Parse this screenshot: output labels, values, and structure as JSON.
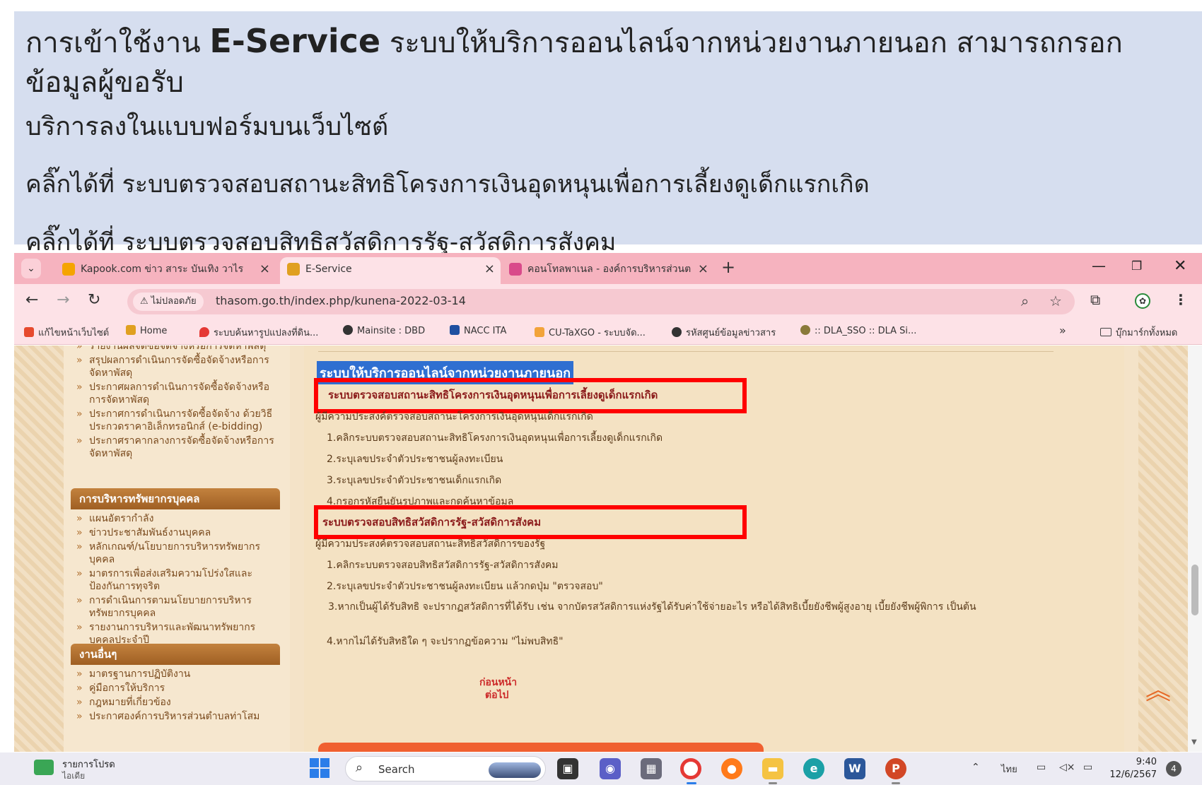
{
  "caption": {
    "line1_pre": "การเข้าใช้งาน ",
    "line1_brand": "E-Service",
    "line1_post": " ระบบให้บริการออนไลน์จากหน่วยงานภายนอก สามารถกรอกข้อมูลผู้ขอรับ",
    "line2": "บริการลงในแบบฟอร์มบนเว็บไซต์",
    "line3": "คลิ๊กได้ที่ ระบบตรวจสอบสถานะสิทธิโครงการเงินอุดหนุนเพื่อการเลี้ยงดูเด็กแรกเกิด",
    "line4": "คลิ๊กได้ที่ ระบบตรวจสอบสิทธิสวัสดิการรัฐ-สวัสดิการสังคม"
  },
  "browser": {
    "tabs": [
      {
        "title": "Kapook.com ข่าว สาระ บันเทิง วาไร",
        "favicon_color": "#f5a400",
        "active": false
      },
      {
        "title": "E-Service",
        "favicon_color": "#e0a020",
        "active": true
      },
      {
        "title": "คอนโทลพาเนล - องค์การบริหารส่วนต",
        "favicon_color": "#d94a8a",
        "active": false
      }
    ],
    "security_label": "ไม่ปลอดภัย",
    "url": "thasom.go.th/index.php/kunena-2022-03-14",
    "bookmarks": [
      "แก้ไขหน้าเว็บไซต์",
      "Home",
      "ระบบค้นหารูปแปลงที่ดิน...",
      "Mainsite : DBD",
      "NACC ITA",
      "CU-TaXGO - ระบบจัด...",
      "รหัสศูนย์ข้อมูลข่าวสาร",
      ":: DLA_SSO :: DLA Si..."
    ],
    "all_bookmarks": "บุ๊กมาร์กทั้งหมด"
  },
  "sidebar": {
    "top_items": [
      "รายงานผลจัดซื้อจัดจ้างหรือการจัดหาพัสดุ",
      "สรุปผลการดำเนินการจัดซื้อจัดจ้างหรือการจัดหาพัสดุ",
      "ประกาศผลการดำเนินการจัดซื้อจัดจ้างหรือการจัดหาพัสดุ",
      "ประกาศการดำเนินการจัดซื้อจัดจ้าง ด้วยวิธีประกวดราคาอิเล็กทรอนิกส์ (e-bidding)",
      "ประกาศราคากลางการจัดซื้อจัดจ้างหรือการจัดหาพัสดุ"
    ],
    "hr_header": "การบริหารทรัพยากรบุคคล",
    "hr_items": [
      "แผนอัตรากำลัง",
      "ข่าวประชาสัมพันธ์งานบุคคล",
      "หลักเกณฑ์/นโยบายการบริหารทรัพยากรบุคคล",
      "มาตรการเพื่อส่งเสริมความโปร่งใสและป้องกันการทุจริต",
      "การดำเนินการตามนโยบายการบริหารทรัพยากรบุคคล",
      "รายงานการบริหารและพัฒนาทรัพยากรบุคคลประจำปี"
    ],
    "other_header": "งานอื่นๆ",
    "other_items": [
      "มาตรฐานการปฏิบัติงาน",
      "คู่มือการให้บริการ",
      "กฎหมายที่เกี่ยวข้อง",
      "ประกาศองค์การบริหารส่วนตำบลท่าโสม"
    ]
  },
  "main": {
    "heading": "ระบบให้บริการออนไลน์จากหน่วยงานภายนอก",
    "sec1_title": "ระบบตรวจสอบสถานะสิทธิโครงการเงินอุดหนุนเพื่อการเลี้ยงดูเด็กแรกเกิด",
    "sec1_desc": "ผู้มีความประสงค์ตรวจสอบสถานะโครงการเงินอุดหนุนเด็กแรกเกิด",
    "sec1_steps": [
      "1.คลิกระบบตรวจสอบสถานะสิทธิโครงการเงินอุดหนุนเพื่อการเลี้ยงดูเด็กแรกเกิด",
      "2.ระบุเลขประจำตัวประชาชนผู้ลงทะเบียน",
      "3.ระบุเลขประจำตัวประชาชนเด็กแรกเกิด",
      "4.กรอกรหัสยืนยันรูปภาพและกดค้นหาข้อมูล"
    ],
    "sec2_title": "ระบบตรวจสอบสิทธิสวัสดิการรัฐ-สวัสดิการสังคม",
    "sec2_desc": "ผู้มีความประสงค์ตรวจสอบสถานะสิทธิสวัสดิการของรัฐ",
    "sec2_steps": [
      "1.คลิกระบบตรวจสอบสิทธิสวัสดิการรัฐ-สวัสดิการสังคม",
      "2.ระบุเลขประจำตัวประชาชนผู้ลงทะเบียน แล้วกดปุ่ม \"ตรวจสอบ\"",
      "3.หากเป็นผู้ได้รับสิทธิ จะปรากฏสวัสดิการที่ได้รับ เช่น จากบัตรสวัสดิการแห่งรัฐได้รับค่าใช้จ่ายอะไร หรือได้สิทธิเบี้ยยังชีพผู้สูงอายุ เบี้ยยังชีพผู้พิการ เป็นต้น",
      "4.หากไม่ได้รับสิทธิใด ๆ จะปรากฏข้อความ \"ไม่พบสิทธิ\""
    ],
    "prev": "ก่อนหน้า",
    "next": "ต่อไป"
  },
  "taskbar": {
    "news_title": "รายการโปรด",
    "news_sub": "ไอเดีย",
    "search_label": "Search",
    "lang": "ไทย",
    "time": "9:40",
    "date": "12/6/2567",
    "notifications": "4"
  }
}
